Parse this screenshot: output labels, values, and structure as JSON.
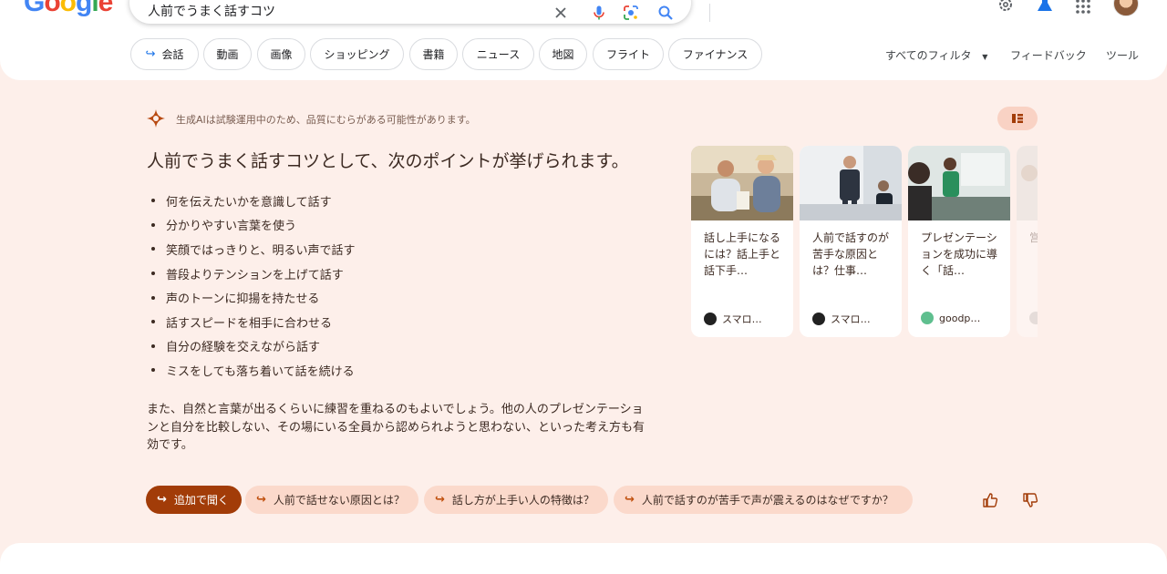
{
  "header": {
    "logo": [
      "G",
      "o",
      "o",
      "g",
      "l",
      "e"
    ],
    "search_value": "人前でうまく話すコツ",
    "tabs": [
      {
        "label": "会話",
        "icon": "arrow-return-icon"
      },
      {
        "label": "動画"
      },
      {
        "label": "画像"
      },
      {
        "label": "ショッピング"
      },
      {
        "label": "書籍"
      },
      {
        "label": "ニュース"
      },
      {
        "label": "地図"
      },
      {
        "label": "フライト"
      },
      {
        "label": "ファイナンス"
      }
    ],
    "all_filters": "すべてのフィルタ",
    "feedback": "フィードバック",
    "tools": "ツール"
  },
  "ai_overview": {
    "notice": "生成AIは試験運用中のため、品質にむらがある可能性があります。",
    "heading": "人前でうまく話すコツとして、次のポイントが挙げられます。",
    "bullets": [
      "何を伝えたいかを意識して話す",
      "分かりやすい言葉を使う",
      "笑顔ではっきりと、明るい声で話す",
      "普段よりテンションを上げて話す",
      "声のトーンに抑揚を持たせる",
      "話すスピードを相手に合わせる",
      "自分の経験を交えながら話す",
      "ミスをしても落ち着いて話を続ける"
    ],
    "paragraph": "また、自然と言葉が出るくらいに練習を重ねるのもよいでしょう。他の人のプレゼンテーションと自分を比較しない、その場にいる全員から認められようと思わない、といった考え方も有効です。",
    "cards": [
      {
        "title": "話し上手になるには？話上手と話下手…",
        "source": "スマロ…"
      },
      {
        "title": "人前で話すのが苦手な原因とは？仕事…",
        "source": "スマロ…"
      },
      {
        "title": "プレゼンテーションを成功に導く「話…",
        "source": "goodp…"
      },
      {
        "title": "営…",
        "source": ""
      }
    ],
    "followups": {
      "main": "追加で聞く",
      "chips": [
        "人前で話せない原因とは？",
        "話し方が上手い人の特徴は？",
        "人前で話すのが苦手で声が震えるのはなぜですか？"
      ]
    }
  },
  "colors": {
    "ai_background": "#fdefea",
    "accent": "#a23c08",
    "chip_background": "#fbd9cb"
  }
}
